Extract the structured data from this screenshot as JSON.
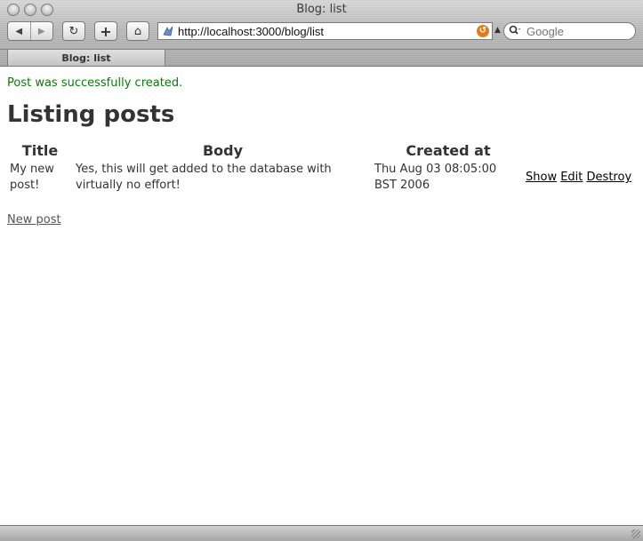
{
  "window": {
    "title": "Blog: list"
  },
  "toolbar": {
    "back_icon": "◀",
    "forward_icon": "▶",
    "reload_icon": "↻",
    "add_icon": "+",
    "home_icon": "⌂",
    "url": "http://localhost:3000/blog/list",
    "search_placeholder": "Google"
  },
  "tab": {
    "label": "Blog: list"
  },
  "page": {
    "notice": "Post was successfully created.",
    "heading": "Listing posts",
    "columns": [
      "Title",
      "Body",
      "Created at"
    ],
    "rows": [
      {
        "title": "My new post!",
        "body": "Yes, this will get added to the database with virtually no effort!",
        "created_at": "Thu Aug 03 08:05:00 BST 2006",
        "actions": [
          "Show",
          "Edit",
          "Destroy"
        ]
      }
    ],
    "new_post_link": "New post"
  },
  "colors": {
    "notice": "#0a7a0a",
    "heading": "#333333",
    "rss": "#e37a1e"
  }
}
